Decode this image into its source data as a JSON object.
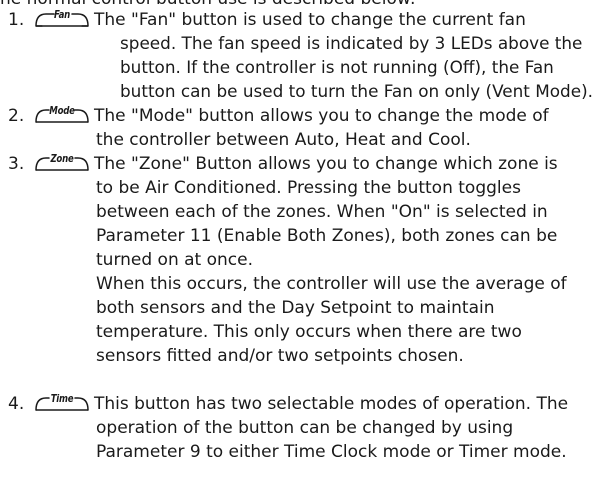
{
  "intro_text": "he normal control button use is described below:",
  "items": [
    {
      "number": "1.",
      "button": "Fan",
      "lines": [
        "The \"Fan\" button is used to change the current fan",
        "speed. The fan speed is indicated by 3 LEDs above the",
        "button. If the controller is not running (Off), the Fan",
        "button can be used to turn the Fan on only (Vent Mode)."
      ]
    },
    {
      "number": "2.",
      "button": "Mode",
      "lines": [
        "The \"Mode\" button allows you to change the mode of",
        "the controller between Auto, Heat and Cool."
      ]
    },
    {
      "number": "3.",
      "button": "Zone",
      "lines": [
        "The \"Zone\" Button allows you to change which zone is",
        "to be Air Conditioned. Pressing the button toggles",
        "between each of the zones. When \"On\" is selected in",
        "Parameter 11 (Enable Both Zones), both zones can be",
        "turned on at once.",
        "When this occurs, the controller will use the average of",
        "both sensors and the Day Setpoint to maintain",
        "temperature. This only occurs when there are two",
        "sensors fitted and/or two setpoints chosen."
      ]
    },
    {
      "number": "4.",
      "button": "Time",
      "lines": [
        "This button has two selectable modes of operation. The",
        "operation of the button can be changed by using",
        "Parameter 9 to either Time Clock mode or Timer mode."
      ]
    }
  ]
}
